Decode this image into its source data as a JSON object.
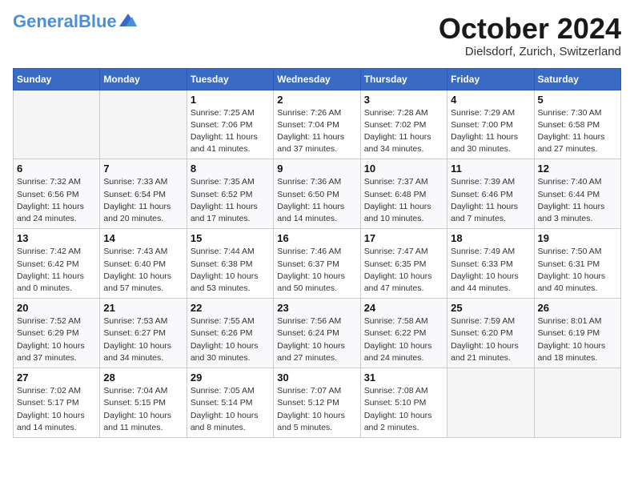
{
  "header": {
    "logo_general": "General",
    "logo_blue": "Blue",
    "month": "October 2024",
    "location": "Dielsdorf, Zurich, Switzerland"
  },
  "days_of_week": [
    "Sunday",
    "Monday",
    "Tuesday",
    "Wednesday",
    "Thursday",
    "Friday",
    "Saturday"
  ],
  "weeks": [
    [
      {
        "day": "",
        "empty": true
      },
      {
        "day": "",
        "empty": true
      },
      {
        "day": "1",
        "sunrise": "7:25 AM",
        "sunset": "7:06 PM",
        "daylight": "11 hours and 41 minutes."
      },
      {
        "day": "2",
        "sunrise": "7:26 AM",
        "sunset": "7:04 PM",
        "daylight": "11 hours and 37 minutes."
      },
      {
        "day": "3",
        "sunrise": "7:28 AM",
        "sunset": "7:02 PM",
        "daylight": "11 hours and 34 minutes."
      },
      {
        "day": "4",
        "sunrise": "7:29 AM",
        "sunset": "7:00 PM",
        "daylight": "11 hours and 30 minutes."
      },
      {
        "day": "5",
        "sunrise": "7:30 AM",
        "sunset": "6:58 PM",
        "daylight": "11 hours and 27 minutes."
      }
    ],
    [
      {
        "day": "6",
        "sunrise": "7:32 AM",
        "sunset": "6:56 PM",
        "daylight": "11 hours and 24 minutes."
      },
      {
        "day": "7",
        "sunrise": "7:33 AM",
        "sunset": "6:54 PM",
        "daylight": "11 hours and 20 minutes."
      },
      {
        "day": "8",
        "sunrise": "7:35 AM",
        "sunset": "6:52 PM",
        "daylight": "11 hours and 17 minutes."
      },
      {
        "day": "9",
        "sunrise": "7:36 AM",
        "sunset": "6:50 PM",
        "daylight": "11 hours and 14 minutes."
      },
      {
        "day": "10",
        "sunrise": "7:37 AM",
        "sunset": "6:48 PM",
        "daylight": "11 hours and 10 minutes."
      },
      {
        "day": "11",
        "sunrise": "7:39 AM",
        "sunset": "6:46 PM",
        "daylight": "11 hours and 7 minutes."
      },
      {
        "day": "12",
        "sunrise": "7:40 AM",
        "sunset": "6:44 PM",
        "daylight": "11 hours and 3 minutes."
      }
    ],
    [
      {
        "day": "13",
        "sunrise": "7:42 AM",
        "sunset": "6:42 PM",
        "daylight": "11 hours and 0 minutes."
      },
      {
        "day": "14",
        "sunrise": "7:43 AM",
        "sunset": "6:40 PM",
        "daylight": "10 hours and 57 minutes."
      },
      {
        "day": "15",
        "sunrise": "7:44 AM",
        "sunset": "6:38 PM",
        "daylight": "10 hours and 53 minutes."
      },
      {
        "day": "16",
        "sunrise": "7:46 AM",
        "sunset": "6:37 PM",
        "daylight": "10 hours and 50 minutes."
      },
      {
        "day": "17",
        "sunrise": "7:47 AM",
        "sunset": "6:35 PM",
        "daylight": "10 hours and 47 minutes."
      },
      {
        "day": "18",
        "sunrise": "7:49 AM",
        "sunset": "6:33 PM",
        "daylight": "10 hours and 44 minutes."
      },
      {
        "day": "19",
        "sunrise": "7:50 AM",
        "sunset": "6:31 PM",
        "daylight": "10 hours and 40 minutes."
      }
    ],
    [
      {
        "day": "20",
        "sunrise": "7:52 AM",
        "sunset": "6:29 PM",
        "daylight": "10 hours and 37 minutes."
      },
      {
        "day": "21",
        "sunrise": "7:53 AM",
        "sunset": "6:27 PM",
        "daylight": "10 hours and 34 minutes."
      },
      {
        "day": "22",
        "sunrise": "7:55 AM",
        "sunset": "6:26 PM",
        "daylight": "10 hours and 30 minutes."
      },
      {
        "day": "23",
        "sunrise": "7:56 AM",
        "sunset": "6:24 PM",
        "daylight": "10 hours and 27 minutes."
      },
      {
        "day": "24",
        "sunrise": "7:58 AM",
        "sunset": "6:22 PM",
        "daylight": "10 hours and 24 minutes."
      },
      {
        "day": "25",
        "sunrise": "7:59 AM",
        "sunset": "6:20 PM",
        "daylight": "10 hours and 21 minutes."
      },
      {
        "day": "26",
        "sunrise": "8:01 AM",
        "sunset": "6:19 PM",
        "daylight": "10 hours and 18 minutes."
      }
    ],
    [
      {
        "day": "27",
        "sunrise": "7:02 AM",
        "sunset": "5:17 PM",
        "daylight": "10 hours and 14 minutes."
      },
      {
        "day": "28",
        "sunrise": "7:04 AM",
        "sunset": "5:15 PM",
        "daylight": "10 hours and 11 minutes."
      },
      {
        "day": "29",
        "sunrise": "7:05 AM",
        "sunset": "5:14 PM",
        "daylight": "10 hours and 8 minutes."
      },
      {
        "day": "30",
        "sunrise": "7:07 AM",
        "sunset": "5:12 PM",
        "daylight": "10 hours and 5 minutes."
      },
      {
        "day": "31",
        "sunrise": "7:08 AM",
        "sunset": "5:10 PM",
        "daylight": "10 hours and 2 minutes."
      },
      {
        "day": "",
        "empty": true
      },
      {
        "day": "",
        "empty": true
      }
    ]
  ]
}
